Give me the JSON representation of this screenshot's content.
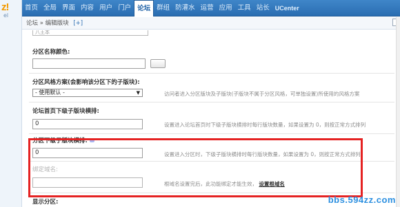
{
  "brand": {
    "logo_mark": "z!",
    "logo_sub": "el"
  },
  "nav": {
    "items": [
      "首页",
      "全局",
      "界面",
      "内容",
      "用户",
      "门户",
      "论坛",
      "群组",
      "防灌水",
      "运营",
      "应用",
      "工具",
      "站长",
      "UCenter"
    ],
    "active": "论坛"
  },
  "breadcrumb": {
    "path": "论坛 » 编辑版块",
    "add": "[+]"
  },
  "form": {
    "prev_field_value": "八王本",
    "color_label": "分区名称颜色:",
    "color_value": "",
    "style_label": "分区风格方案(会影响该分区下的子版块):",
    "style_selected": "- 使用默认 -",
    "style_tip": "访问者进入分区版块及子版块(子版块不属于分区风格，可单独设置)所使用的风格方案",
    "home_cols_label": "论坛首页下级子版块横排:",
    "home_cols_value": "0",
    "home_cols_tip": "设置进入论坛首页时下级子版块横排时每行版块数量，如果设置为 0，则按正常方式排列",
    "sub_cols_label": "分区下级子版块横排:",
    "sub_cols_value": "0",
    "sub_cols_tip": "设置进入分区时，下级子版块横排时每行版块数量，如果设置为 0，则按正常方式排列",
    "domain_label": "绑定域名:",
    "domain_value": "",
    "domain_tip": "根域名设置完后，此功能绑定才能生效，",
    "domain_link": "设置根域名",
    "next_label": "显示分区:"
  },
  "watermark": "bbs.594zz.com",
  "colors": {
    "nav_bg": "#2a6db1",
    "highlight_border": "#e52222",
    "watermark": "#2b8fe0"
  }
}
